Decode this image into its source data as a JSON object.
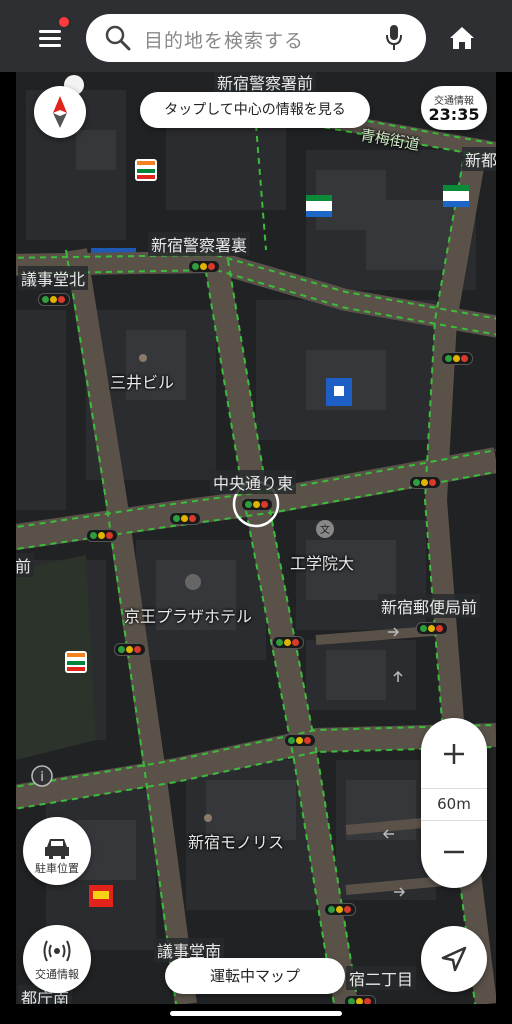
{
  "search": {
    "placeholder": "目的地を検索する"
  },
  "center_info_button": "タップして中心の情報を見る",
  "traffic_info": {
    "label": "交通情報",
    "time": "23:35"
  },
  "map": {
    "labels": {
      "shinjuku_keisatsusho_mae": "新宿警察署前",
      "ome_kaido": "青梅街道",
      "shinto": "新都",
      "shinjuku_keisatsusho_ura": "新宿警察署裏",
      "gijidou_kita": "議事堂北",
      "mitsui_bldg": "三井ビル",
      "chuo_dori_higashi": "中央通り東",
      "mae": "前",
      "kogakuin": "工学院大",
      "keio_plaza": "京王プラザホテル",
      "yubin_mae": "新宿郵便局前",
      "monolith": "新宿モノリス",
      "gijidou_minami": "議事堂南",
      "nichome": "宿二丁目",
      "tochomae": "都庁南"
    },
    "scale": "60m"
  },
  "parking_button": "駐車位置",
  "traffic_button": "交通情報",
  "drive_map_button": "運転中マップ",
  "icons": {
    "menu": "hamburger-menu-icon",
    "search": "magnifier-icon",
    "mic": "microphone-icon",
    "home": "home-icon",
    "compass": "compass-icon",
    "parking": "car-icon",
    "traffic": "broadcast-icon",
    "locate": "navigation-arrow-icon"
  },
  "colors": {
    "road": "#5a5249",
    "park": "#2f3a2a",
    "route_dash": "#3bbd3b",
    "water": "#1e5ab4"
  }
}
